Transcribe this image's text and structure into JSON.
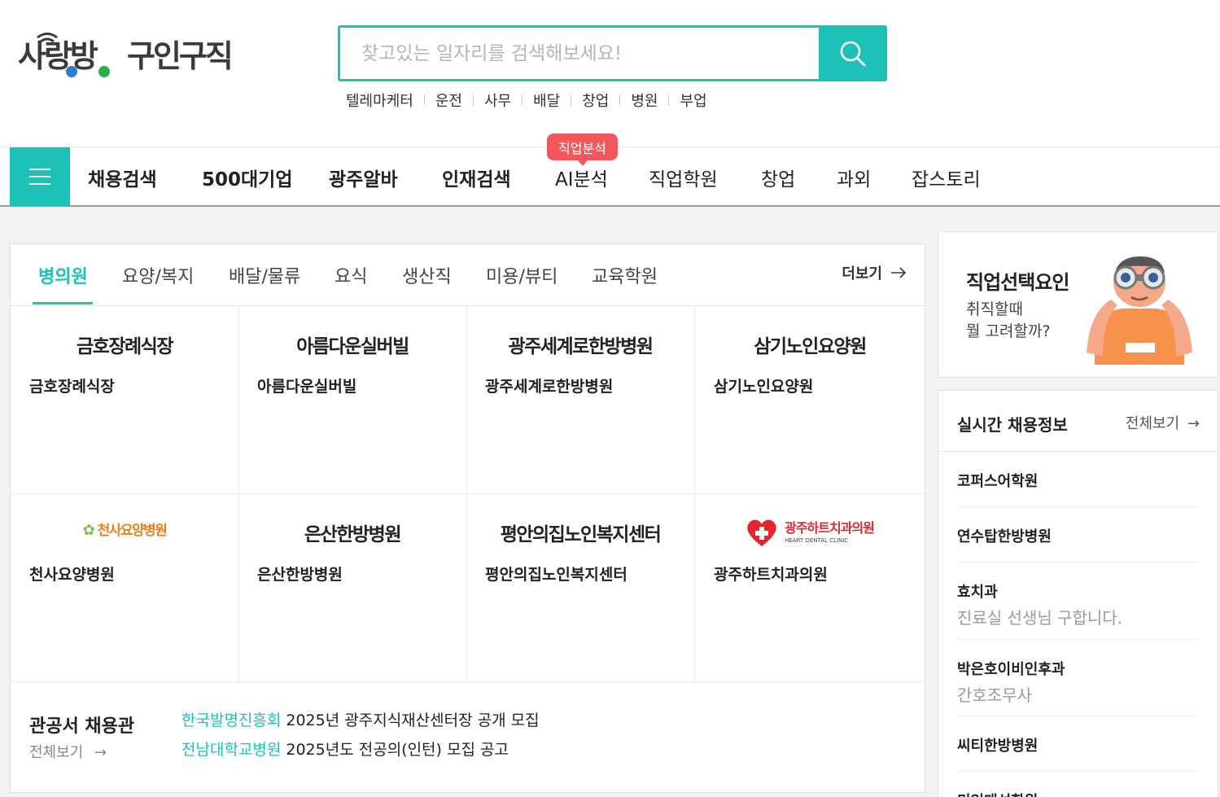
{
  "header": {
    "logo_text": "사랑방 구인구직",
    "logo_part1": "사랑방",
    "logo_part2": "구인구직",
    "search_placeholder": "찾고있는 일자리를 검색해보세요!",
    "keywords": [
      "텔레마케터",
      "운전",
      "사무",
      "배달",
      "창업",
      "병원",
      "부업"
    ]
  },
  "nav": {
    "items": [
      {
        "label": "채용검색",
        "bold": true
      },
      {
        "label": "500대기업",
        "bold": true
      },
      {
        "label": "광주알바",
        "bold": true
      },
      {
        "label": "인재검색",
        "bold": true
      },
      {
        "label": "AI분석",
        "bold": false
      },
      {
        "label": "직업학원",
        "bold": false
      },
      {
        "label": "창업",
        "bold": false
      },
      {
        "label": "과외",
        "bold": false
      },
      {
        "label": "잡스토리",
        "bold": false
      }
    ],
    "ai_badge": "직업분석"
  },
  "main": {
    "tabs": [
      "병의원",
      "요양/복지",
      "배달/물류",
      "요식",
      "생산직",
      "미용/뷰티",
      "교육학원"
    ],
    "active_tab": "병의원",
    "more_label": "더보기",
    "companies": [
      {
        "logo": "금호장례식장",
        "name": "금호장례식장"
      },
      {
        "logo": "아름다운실버빌",
        "name": "아름다운실버빌"
      },
      {
        "logo": "광주세계로한방병원",
        "name": "광주세계로한방병원"
      },
      {
        "logo": "삼기노인요양원",
        "name": "삼기노인요양원"
      },
      {
        "logo": "천사요양병원",
        "name": "천사요양병원"
      },
      {
        "logo": "은산한방병원",
        "name": "은산한방병원"
      },
      {
        "logo": "평안의집노인복지센터",
        "name": "평안의집노인복지센터"
      },
      {
        "logo": "광주하트치과의원",
        "name": "광주하트치과의원",
        "logo_sub": "HEART DENTAL CLINIC"
      }
    ],
    "public": {
      "title": "관공서 채용관",
      "more": "전체보기",
      "items": [
        {
          "org": "한국발명진흥회",
          "text": "2025년 광주지식재산센터장 공개 모집"
        },
        {
          "org": "전남대학교병원",
          "text": "2025년도 전공의(인턴) 모집 공고"
        }
      ]
    }
  },
  "side": {
    "banner": {
      "title": "직업선택요인",
      "sub_line1": "취직할때",
      "sub_line2": "뭘 고려할까?"
    },
    "realtime": {
      "title": "실시간 채용정보",
      "more": "전체보기",
      "items": [
        {
          "name": "코퍼스어학원",
          "desc": ""
        },
        {
          "name": "연수탑한방병원",
          "desc": ""
        },
        {
          "name": "효치과",
          "desc": "진료실 선생님 구합니다."
        },
        {
          "name": "박은호이비인후과",
          "desc": "간호조무사"
        },
        {
          "name": "씨티한방병원",
          "desc": ""
        },
        {
          "name": "미인매선학원",
          "desc": ""
        }
      ]
    }
  },
  "colors": {
    "accent": "#1dc1b8",
    "badge": "#f2585b",
    "logo_dark": "#3a3a3a",
    "logo_blue": "#2b7fd4",
    "logo_green": "#27b34a"
  }
}
